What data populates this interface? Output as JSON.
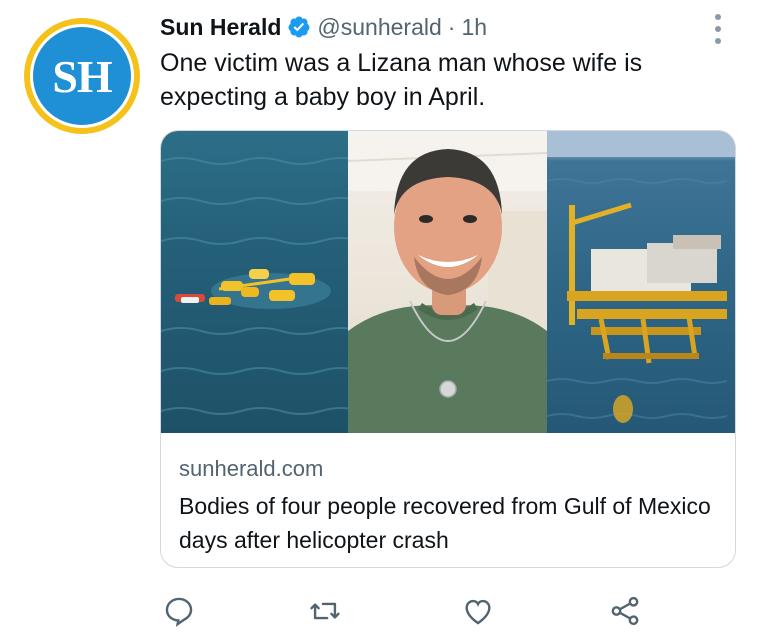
{
  "avatar": {
    "text": "SH",
    "ring_color": "#f5c21b",
    "fill_color": "#1f8fd6"
  },
  "tweet": {
    "display_name": "Sun Herald",
    "verified_icon": "verified-badge-icon",
    "handle": "@sunherald",
    "separator": "·",
    "time": "1h",
    "text": "One victim was a Lizana man whose wife is expecting a baby boy in April."
  },
  "card": {
    "images": [
      {
        "name": "helicopter-debris-photo",
        "description_icon": "sea-debris-image"
      },
      {
        "name": "victim-portrait-photo",
        "description_icon": "portrait-image"
      },
      {
        "name": "oil-platform-photo",
        "description_icon": "oil-rig-image"
      }
    ],
    "domain": "sunherald.com",
    "title": "Bodies of four people recovered from Gulf of Mexico days after helicopter crash"
  },
  "actions": [
    {
      "name": "reply-icon"
    },
    {
      "name": "retweet-icon"
    },
    {
      "name": "like-icon"
    },
    {
      "name": "share-icon"
    }
  ],
  "colors": {
    "text": "#0f1419",
    "secondary": "#536471",
    "border": "#cfd9de",
    "verified": "#1d9bf0"
  }
}
